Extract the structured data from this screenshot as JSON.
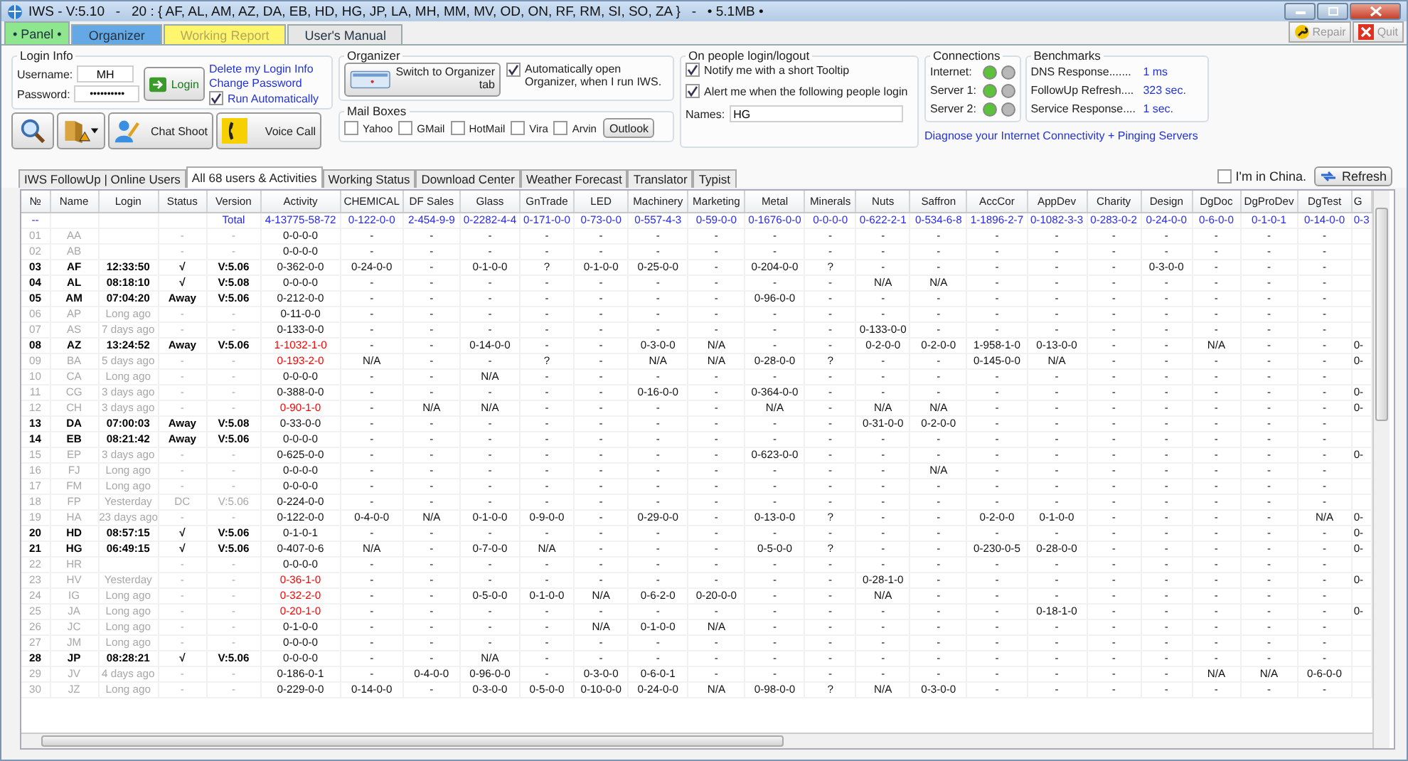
{
  "window": {
    "title": "IWS - V:5.10   -   20 : { AF, AL, AM, AZ, DA, EB, HD, HG, JP, LA, MH, MM, MV, OD, ON, RF, RM, SI, SO, ZA }   -   • 5.1MB •"
  },
  "tabs": [
    {
      "label": "• Panel •",
      "selected": true,
      "disabled": false,
      "color": "#8ee68e"
    },
    {
      "label": "Organizer",
      "selected": false,
      "disabled": false,
      "color": "#64a8e6"
    },
    {
      "label": "Working Report",
      "selected": false,
      "disabled": true,
      "color": "#fff66e"
    },
    {
      "label": "User's Manual",
      "selected": false,
      "disabled": false,
      "color": "#e6e6e6"
    }
  ],
  "toolbar_buttons": [
    {
      "kind": "repair",
      "label": "Repair",
      "disabled": true
    },
    {
      "kind": "quit",
      "label": "Quit",
      "disabled": true
    }
  ],
  "login": {
    "title": "Login Info",
    "username_label": "Username:",
    "username": "MH",
    "password_label": "Password:",
    "password": "••••••••••",
    "login_button": "Login",
    "links": [
      "Delete my Login Info",
      "Change Password"
    ],
    "run_automatically": {
      "label": "Run Automatically",
      "checked": true
    }
  },
  "tools": [
    {
      "kind": "search"
    },
    {
      "kind": "folder"
    },
    {
      "kind": "chat",
      "label": "Chat Shoot"
    },
    {
      "kind": "call",
      "label": "Voice Call"
    }
  ],
  "organizer": {
    "title": "Organizer",
    "switch_button": "Switch to Organizer tab",
    "auto_open": {
      "label": "Automatically open Organizer, when I run IWS.",
      "checked": true
    }
  },
  "mail_boxes": {
    "title": "Mail Boxes",
    "items": [
      {
        "label": "Yahoo",
        "checked": false
      },
      {
        "label": "GMail",
        "checked": false
      },
      {
        "label": "HotMail",
        "checked": false
      },
      {
        "label": "Vira",
        "checked": false
      },
      {
        "label": "Arvin",
        "checked": false
      }
    ],
    "outlook_button": "Outlook"
  },
  "notifications": {
    "title": "On people login/logout",
    "options": [
      {
        "label": "Notify me with a short Tooltip",
        "checked": true
      },
      {
        "label": "Alert me when the following people login",
        "checked": true
      }
    ],
    "names_label": "Names:",
    "names": "HG"
  },
  "connections": {
    "title": "Connections",
    "items": [
      {
        "label": "Internet:",
        "ok": true
      },
      {
        "label": "Server 1:",
        "ok": true
      },
      {
        "label": "Server 2:",
        "ok": true
      }
    ]
  },
  "benchmarks": {
    "title": "Benchmarks",
    "items": [
      {
        "label": "DNS Response.......",
        "value": "1 ms"
      },
      {
        "label": "FollowUp Refresh....",
        "value": "323 sec."
      },
      {
        "label": "Service Response....",
        "value": "1 sec."
      }
    ]
  },
  "diagnose_link": "Diagnose your Internet Connectivity + Pinging Servers",
  "subtabs": [
    {
      "label": "IWS FollowUp | Online Users",
      "selected": false
    },
    {
      "label": "All 68 users & Activities",
      "selected": true
    },
    {
      "label": "Working Status",
      "selected": false
    },
    {
      "label": "Download Center",
      "selected": false
    },
    {
      "label": "Weather Forecast",
      "selected": false
    },
    {
      "label": "Translator",
      "selected": false
    },
    {
      "label": "Typist",
      "selected": false
    }
  ],
  "china": {
    "label": "I'm in China.",
    "checked": false
  },
  "refresh_button": "Refresh",
  "table": {
    "columns": [
      "№",
      "Name",
      "Login",
      "Status",
      "Version",
      "Activity",
      "CHEMICAL",
      "DF Sales",
      "Glass",
      "GnTrade",
      "LED",
      "Machinery",
      "Marketing",
      "Metal",
      "Minerals",
      "Nuts",
      "Saffron",
      "AccCor",
      "AppDev",
      "Charity",
      "Design",
      "DgDoc",
      "DgProDev",
      "DgTest",
      "G"
    ],
    "total": {
      "no": "--",
      "version": "Total",
      "activity": "4-13775-58-72",
      "values": [
        "0-122-0-0",
        "2-454-9-9",
        "0-2282-4-4",
        "0-171-0-0",
        "0-73-0-0",
        "0-557-4-3",
        "0-59-0-0",
        "0-1676-0-0",
        "0-0-0-0",
        "0-622-2-1",
        "0-534-6-8",
        "1-1896-2-7",
        "0-1082-3-3",
        "0-283-0-2",
        "0-24-0-0",
        "0-6-0-0",
        "0-1-0-1",
        "0-14-0-0"
      ],
      "last": "0-3"
    },
    "rows": [
      {
        "no": "01",
        "name": "AA",
        "status": "-",
        "version": "-",
        "online": false,
        "alert": false,
        "activity": "0-0-0-0",
        "values": [
          "-",
          "-",
          "-",
          "-",
          "-",
          "-",
          "-",
          "-",
          "-",
          "-",
          "-",
          "-",
          "-",
          "-",
          "-",
          "-",
          "-",
          "-"
        ]
      },
      {
        "no": "02",
        "name": "AB",
        "status": "-",
        "version": "-",
        "online": false,
        "alert": false,
        "activity": "0-0-0-0",
        "values": [
          "-",
          "-",
          "-",
          "-",
          "-",
          "-",
          "-",
          "-",
          "-",
          "-",
          "-",
          "-",
          "-",
          "-",
          "-",
          "-",
          "-",
          "-"
        ]
      },
      {
        "no": "03",
        "name": "AF",
        "login": "12:33:50",
        "status": "√",
        "version": "V:5.06",
        "online": true,
        "alert": false,
        "activity": "0-362-0-0",
        "values": [
          "0-24-0-0",
          "-",
          "0-1-0-0",
          "?",
          "0-1-0-0",
          "0-25-0-0",
          "-",
          "0-204-0-0",
          "?",
          "-",
          "-",
          "-",
          "-",
          "-",
          "0-3-0-0",
          "-",
          "-",
          "-"
        ]
      },
      {
        "no": "04",
        "name": "AL",
        "login": "08:18:10",
        "status": "√",
        "version": "V:5.08",
        "online": true,
        "alert": false,
        "activity": "0-0-0-0",
        "values": [
          "-",
          "-",
          "-",
          "-",
          "-",
          "-",
          "-",
          "-",
          "-",
          "N/A",
          "N/A",
          "-",
          "-",
          "-",
          "-",
          "-",
          "-",
          "-"
        ]
      },
      {
        "no": "05",
        "name": "AM",
        "login": "07:04:20",
        "status": "Away",
        "version": "V:5.06",
        "online": true,
        "alert": false,
        "activity": "0-212-0-0",
        "values": [
          "-",
          "-",
          "-",
          "-",
          "-",
          "-",
          "-",
          "0-96-0-0",
          "-",
          "-",
          "-",
          "-",
          "-",
          "-",
          "-",
          "-",
          "-",
          "-"
        ]
      },
      {
        "no": "06",
        "name": "AP",
        "login": "Long ago",
        "status": "-",
        "version": "-",
        "online": false,
        "alert": false,
        "activity": "0-11-0-0",
        "values": [
          "-",
          "-",
          "-",
          "-",
          "-",
          "-",
          "-",
          "-",
          "-",
          "-",
          "-",
          "-",
          "-",
          "-",
          "-",
          "-",
          "-",
          "-"
        ]
      },
      {
        "no": "07",
        "name": "AS",
        "login": "7 days ago",
        "status": "-",
        "version": "-",
        "online": false,
        "alert": false,
        "activity": "0-133-0-0",
        "values": [
          "-",
          "-",
          "-",
          "-",
          "-",
          "-",
          "-",
          "-",
          "-",
          "0-133-0-0",
          "-",
          "-",
          "-",
          "-",
          "-",
          "-",
          "-",
          "-"
        ]
      },
      {
        "no": "08",
        "name": "AZ",
        "login": "13:24:52",
        "status": "Away",
        "version": "V:5.06",
        "online": true,
        "alert": true,
        "activity": "1-1032-1-0",
        "values": [
          "-",
          "-",
          "0-14-0-0",
          "-",
          "-",
          "0-3-0-0",
          "N/A",
          "-",
          "-",
          "0-2-0-0",
          "0-2-0-0",
          "1-958-1-0",
          "0-13-0-0",
          "-",
          "-",
          "N/A",
          "-",
          "-"
        ],
        "last": "0-"
      },
      {
        "no": "09",
        "name": "BA",
        "login": "5 days ago",
        "status": "-",
        "version": "-",
        "online": false,
        "alert": true,
        "activity": "0-193-2-0",
        "values": [
          "N/A",
          "-",
          "-",
          "?",
          "-",
          "N/A",
          "N/A",
          "0-28-0-0",
          "?",
          "-",
          "-",
          "0-145-0-0",
          "N/A",
          "-",
          "-",
          "-",
          "-",
          "-"
        ],
        "last": "0-"
      },
      {
        "no": "10",
        "name": "CA",
        "login": "Long ago",
        "status": "-",
        "version": "-",
        "online": false,
        "alert": false,
        "activity": "0-0-0-0",
        "values": [
          "-",
          "-",
          "N/A",
          "-",
          "-",
          "-",
          "-",
          "-",
          "-",
          "-",
          "-",
          "-",
          "-",
          "-",
          "-",
          "-",
          "-",
          "-"
        ]
      },
      {
        "no": "11",
        "name": "CG",
        "login": "3 days ago",
        "status": "-",
        "version": "-",
        "online": false,
        "alert": false,
        "activity": "0-388-0-0",
        "values": [
          "-",
          "-",
          "-",
          "-",
          "-",
          "0-16-0-0",
          "-",
          "0-364-0-0",
          "-",
          "-",
          "-",
          "-",
          "-",
          "-",
          "-",
          "-",
          "-",
          "-"
        ],
        "last": "0-"
      },
      {
        "no": "12",
        "name": "CH",
        "login": "3 days ago",
        "status": "-",
        "version": "-",
        "online": false,
        "alert": true,
        "activity": "0-90-1-0",
        "values": [
          "-",
          "N/A",
          "N/A",
          "-",
          "-",
          "-",
          "-",
          "N/A",
          "-",
          "N/A",
          "N/A",
          "-",
          "-",
          "-",
          "-",
          "-",
          "-",
          "-"
        ],
        "last": "0-"
      },
      {
        "no": "13",
        "name": "DA",
        "login": "07:00:03",
        "status": "Away",
        "version": "V:5.08",
        "online": true,
        "alert": false,
        "activity": "0-33-0-0",
        "values": [
          "-",
          "-",
          "-",
          "-",
          "-",
          "-",
          "-",
          "-",
          "-",
          "0-31-0-0",
          "0-2-0-0",
          "-",
          "-",
          "-",
          "-",
          "-",
          "-",
          "-"
        ]
      },
      {
        "no": "14",
        "name": "EB",
        "login": "08:21:42",
        "status": "Away",
        "version": "V:5.06",
        "online": true,
        "alert": false,
        "activity": "0-0-0-0",
        "values": [
          "-",
          "-",
          "-",
          "-",
          "-",
          "-",
          "-",
          "-",
          "-",
          "-",
          "-",
          "-",
          "-",
          "-",
          "-",
          "-",
          "-",
          "-"
        ]
      },
      {
        "no": "15",
        "name": "EP",
        "login": "3 days ago",
        "status": "-",
        "version": "-",
        "online": false,
        "alert": false,
        "activity": "0-625-0-0",
        "values": [
          "-",
          "-",
          "-",
          "-",
          "-",
          "-",
          "-",
          "0-623-0-0",
          "-",
          "-",
          "-",
          "-",
          "-",
          "-",
          "-",
          "-",
          "-",
          "-"
        ],
        "last": "0-"
      },
      {
        "no": "16",
        "name": "FJ",
        "login": "Long ago",
        "status": "-",
        "version": "-",
        "online": false,
        "alert": false,
        "activity": "0-0-0-0",
        "values": [
          "-",
          "-",
          "-",
          "-",
          "-",
          "-",
          "-",
          "-",
          "-",
          "-",
          "N/A",
          "-",
          "-",
          "-",
          "-",
          "-",
          "-",
          "-"
        ]
      },
      {
        "no": "17",
        "name": "FM",
        "login": "Long ago",
        "status": "-",
        "version": "-",
        "online": false,
        "alert": false,
        "activity": "0-0-0-0",
        "values": [
          "-",
          "-",
          "-",
          "-",
          "-",
          "-",
          "-",
          "-",
          "-",
          "-",
          "-",
          "-",
          "-",
          "-",
          "-",
          "-",
          "-",
          "-"
        ]
      },
      {
        "no": "18",
        "name": "FP",
        "login": "Yesterday",
        "status": "DC",
        "version": "V:5.06",
        "online": false,
        "alert": false,
        "activity": "0-224-0-0",
        "values": [
          "-",
          "-",
          "-",
          "-",
          "-",
          "-",
          "-",
          "-",
          "-",
          "-",
          "-",
          "-",
          "-",
          "-",
          "-",
          "-",
          "-",
          "-"
        ]
      },
      {
        "no": "19",
        "name": "HA",
        "login": "23 days ago",
        "status": "-",
        "version": "-",
        "online": false,
        "alert": false,
        "activity": "0-122-0-0",
        "values": [
          "0-4-0-0",
          "N/A",
          "0-1-0-0",
          "0-9-0-0",
          "-",
          "0-29-0-0",
          "-",
          "0-13-0-0",
          "?",
          "-",
          "-",
          "0-2-0-0",
          "0-1-0-0",
          "-",
          "-",
          "-",
          "-",
          "N/A"
        ],
        "last": "0-"
      },
      {
        "no": "20",
        "name": "HD",
        "login": "08:57:15",
        "status": "√",
        "version": "V:5.06",
        "online": true,
        "alert": false,
        "activity": "0-1-0-1",
        "values": [
          "-",
          "-",
          "-",
          "-",
          "-",
          "-",
          "-",
          "-",
          "-",
          "-",
          "-",
          "-",
          "-",
          "-",
          "-",
          "-",
          "-",
          "-"
        ],
        "last": "0-"
      },
      {
        "no": "21",
        "name": "HG",
        "login": "06:49:15",
        "status": "√",
        "version": "V:5.06",
        "online": true,
        "alert": false,
        "activity": "0-407-0-6",
        "values": [
          "N/A",
          "-",
          "0-7-0-0",
          "N/A",
          "-",
          "-",
          "-",
          "0-5-0-0",
          "?",
          "-",
          "-",
          "0-230-0-5",
          "0-28-0-0",
          "-",
          "-",
          "-",
          "-",
          "-"
        ],
        "last": "0-"
      },
      {
        "no": "22",
        "name": "HR",
        "status": "-",
        "version": "-",
        "online": false,
        "alert": false,
        "activity": "0-0-0-0",
        "values": [
          "-",
          "-",
          "-",
          "-",
          "-",
          "-",
          "-",
          "-",
          "-",
          "-",
          "-",
          "-",
          "-",
          "-",
          "-",
          "-",
          "-",
          "-"
        ]
      },
      {
        "no": "23",
        "name": "HV",
        "login": "Yesterday",
        "status": "-",
        "version": "-",
        "online": false,
        "alert": true,
        "activity": "0-36-1-0",
        "values": [
          "-",
          "-",
          "-",
          "-",
          "-",
          "-",
          "-",
          "-",
          "-",
          "0-28-1-0",
          "-",
          "-",
          "-",
          "-",
          "-",
          "-",
          "-",
          "-"
        ],
        "last": "0-"
      },
      {
        "no": "24",
        "name": "IG",
        "login": "Long ago",
        "status": "-",
        "version": "-",
        "online": false,
        "alert": true,
        "activity": "0-32-2-0",
        "values": [
          "-",
          "-",
          "0-5-0-0",
          "0-1-0-0",
          "N/A",
          "0-6-2-0",
          "0-20-0-0",
          "-",
          "-",
          "N/A",
          "-",
          "-",
          "-",
          "-",
          "-",
          "-",
          "-",
          "-"
        ]
      },
      {
        "no": "25",
        "name": "JA",
        "login": "Long ago",
        "status": "-",
        "version": "-",
        "online": false,
        "alert": true,
        "activity": "0-20-1-0",
        "values": [
          "-",
          "-",
          "-",
          "-",
          "-",
          "-",
          "-",
          "-",
          "-",
          "-",
          "-",
          "-",
          "0-18-1-0",
          "-",
          "-",
          "-",
          "-",
          "-"
        ],
        "last": "0-"
      },
      {
        "no": "26",
        "name": "JC",
        "login": "Long ago",
        "status": "-",
        "version": "-",
        "online": false,
        "alert": false,
        "activity": "0-1-0-0",
        "values": [
          "-",
          "-",
          "-",
          "-",
          "N/A",
          "0-1-0-0",
          "N/A",
          "-",
          "-",
          "-",
          "-",
          "-",
          "-",
          "-",
          "-",
          "-",
          "-",
          "-"
        ]
      },
      {
        "no": "27",
        "name": "JM",
        "login": "Long ago",
        "status": "-",
        "version": "-",
        "online": false,
        "alert": false,
        "activity": "0-0-0-0",
        "values": [
          "-",
          "-",
          "-",
          "-",
          "-",
          "-",
          "-",
          "-",
          "-",
          "-",
          "-",
          "-",
          "-",
          "-",
          "-",
          "-",
          "-",
          "-"
        ]
      },
      {
        "no": "28",
        "name": "JP",
        "login": "08:28:21",
        "status": "√",
        "version": "V:5.06",
        "online": true,
        "alert": false,
        "activity": "0-0-0-0",
        "values": [
          "-",
          "-",
          "N/A",
          "-",
          "-",
          "-",
          "-",
          "-",
          "-",
          "-",
          "-",
          "-",
          "-",
          "-",
          "-",
          "-",
          "-",
          "-"
        ]
      },
      {
        "no": "29",
        "name": "JV",
        "login": "4 days ago",
        "status": "-",
        "version": "-",
        "online": false,
        "alert": false,
        "activity": "0-186-0-1",
        "values": [
          "-",
          "0-4-0-0",
          "0-96-0-0",
          "-",
          "0-3-0-0",
          "0-6-0-1",
          "-",
          "-",
          "-",
          "-",
          "-",
          "-",
          "-",
          "-",
          "-",
          "N/A",
          "N/A",
          "0-6-0-0"
        ]
      },
      {
        "no": "30",
        "name": "JZ",
        "login": "Long ago",
        "status": "-",
        "version": "-",
        "online": false,
        "alert": false,
        "activity": "0-229-0-0",
        "values": [
          "0-14-0-0",
          "-",
          "0-3-0-0",
          "0-5-0-0",
          "0-10-0-0",
          "0-24-0-0",
          "N/A",
          "0-98-0-0",
          "?",
          "N/A",
          "0-3-0-0",
          "-",
          "-",
          "-",
          "-",
          "-",
          "-",
          "-"
        ]
      }
    ]
  }
}
